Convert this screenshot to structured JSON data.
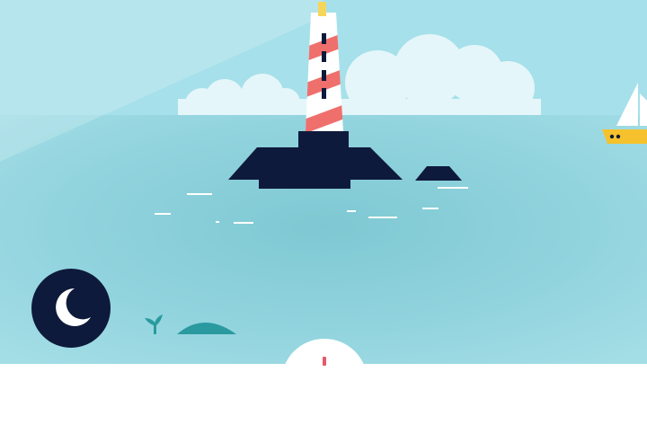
{
  "scene": {
    "sky_color": "#a6e0ea",
    "sea_color": "#8ed2dc",
    "cloud_color": "#e4f6f9",
    "rock_color": "#0e1a3b",
    "lighthouse_stripe_color": "#ef6f6c",
    "lighthouse_white": "#ffffff",
    "light_color": "#f6d65a"
  },
  "controls": {
    "night_mode_icon": "moon-icon",
    "night_mode_button_color": "#0e1a3b",
    "compass_icon": "compass-icon"
  },
  "objects": {
    "boat_hull_color": "#f5c22d",
    "whale_color": "#2a9aa0"
  }
}
